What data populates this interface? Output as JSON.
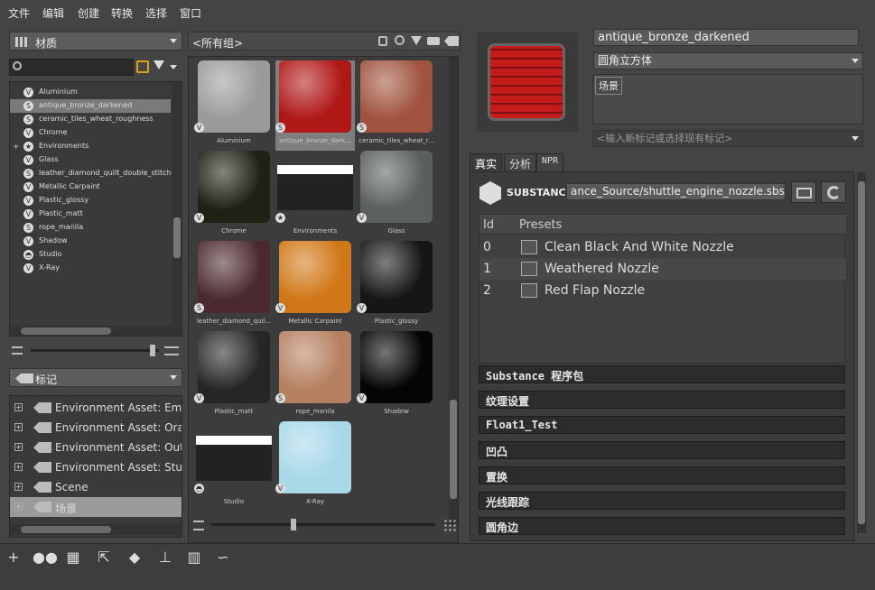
{
  "menubar": {
    "items": [
      "文件",
      "编辑",
      "创建",
      "转换",
      "选择",
      "窗口"
    ]
  },
  "left": {
    "material_dropdown": "材质",
    "materials": [
      {
        "name": "Aluminium",
        "icon": "v"
      },
      {
        "name": "antique_bronze_darkened",
        "icon": "s",
        "selected": true
      },
      {
        "name": "ceramic_tiles_wheat_roughness",
        "icon": "s"
      },
      {
        "name": "Chrome",
        "icon": "v"
      },
      {
        "name": "Environments",
        "icon": "env",
        "expandable": true
      },
      {
        "name": "Glass",
        "icon": "v"
      },
      {
        "name": "leather_diamond_quilt_double_stitch",
        "icon": "s"
      },
      {
        "name": "Metallic Carpaint",
        "icon": "v"
      },
      {
        "name": "Plastic_glossy",
        "icon": "v"
      },
      {
        "name": "Plastic_matt",
        "icon": "v"
      },
      {
        "name": "rope_manila",
        "icon": "s"
      },
      {
        "name": "Shadow",
        "icon": "v"
      },
      {
        "name": "Studio",
        "icon": "studio"
      },
      {
        "name": "X-Ray",
        "icon": "v"
      }
    ],
    "tag_dropdown": "标记",
    "tags": [
      {
        "name": "Environment Asset: Empt"
      },
      {
        "name": "Environment Asset: Oran"
      },
      {
        "name": "Environment Asset: Outd"
      },
      {
        "name": "Environment Asset: Studi"
      },
      {
        "name": "Scene"
      },
      {
        "name": "场景",
        "selected": true
      }
    ]
  },
  "grid": {
    "group_dropdown": "<所有组>",
    "thumbnails": [
      {
        "name": "Aluminium",
        "badge": "v",
        "color": "#9a9a9a"
      },
      {
        "name": "antique_bronze_dark...",
        "badge": "s",
        "color": "#b01818",
        "selected": true
      },
      {
        "name": "ceramic_tiles_wheat_r...",
        "badge": "s",
        "color": "#a0533e"
      },
      {
        "name": "Chrome",
        "badge": "v",
        "color": "#202015"
      },
      {
        "name": "Environments",
        "badge": "env",
        "color": "#ffffff"
      },
      {
        "name": "Glass",
        "badge": "v",
        "color": "#5a5f5f"
      },
      {
        "name": "leather_diamond_quil...",
        "badge": "s",
        "color": "#4a2a30"
      },
      {
        "name": "Metallic Carpaint",
        "badge": "v",
        "color": "#d07818"
      },
      {
        "name": "Plastic_glossy",
        "badge": "v",
        "color": "#161616"
      },
      {
        "name": "Plastic_matt",
        "badge": "v",
        "color": "#262626"
      },
      {
        "name": "rope_manila",
        "badge": "s",
        "color": "#b58060"
      },
      {
        "name": "Shadow",
        "badge": "v",
        "color": "#050505"
      },
      {
        "name": "Studio",
        "badge": "studio",
        "color": "#ffffff"
      },
      {
        "name": "X-Ray",
        "badge": "v",
        "color": "#a8d8e8"
      }
    ]
  },
  "right": {
    "material_name": "antique_bronze_darkened",
    "shape": "圆角立方体",
    "tags_box": "场景",
    "tag_input_placeholder": "<输入新标记或选择现有标记>",
    "tabs": [
      "真实",
      "分析",
      "NPR"
    ],
    "substance_logo": "SUBSTANCE",
    "sbsar_path": "ance_Source/shuttle_engine_nozzle.sbsar",
    "presets_header": {
      "id": "Id",
      "presets": "Presets"
    },
    "presets": [
      {
        "id": "0",
        "name": "Clean Black And White Nozzle"
      },
      {
        "id": "1",
        "name": "Weathered Nozzle"
      },
      {
        "id": "2",
        "name": "Red Flap Nozzle"
      }
    ],
    "sections": [
      "Substance 程序包",
      "纹理设置",
      "Float1_Test",
      "凹凸",
      "置换",
      "光线跟踪",
      "圆角边"
    ]
  }
}
